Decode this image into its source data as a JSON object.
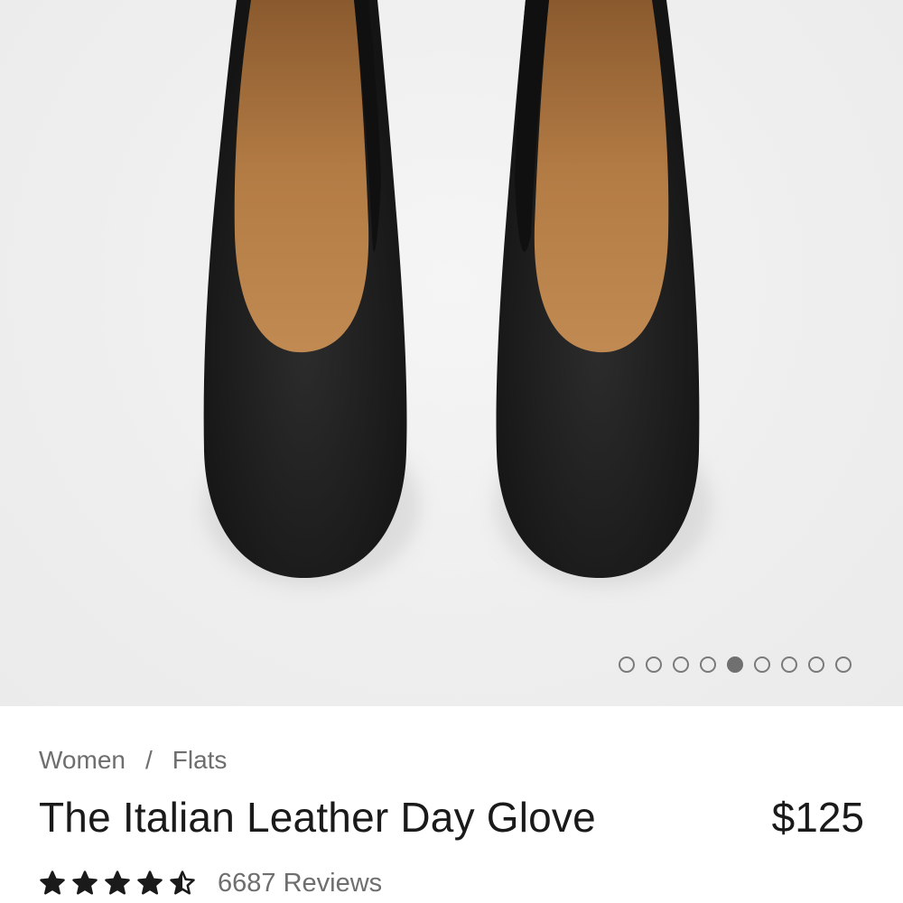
{
  "gallery": {
    "image_alt": "Black leather flats, top view",
    "slide_count": 9,
    "active_slide": 5
  },
  "breadcrumb": {
    "items": [
      "Women",
      "Flats"
    ],
    "separator": "/"
  },
  "product": {
    "title": "The Italian Leather Day Glove",
    "price": "$125"
  },
  "rating": {
    "stars": 4.5,
    "max_stars": 5,
    "reviews_label": "6687 Reviews"
  },
  "colors": {
    "text": "#1a1a1a",
    "muted": "#6e6e6e",
    "hero_bg": "#eeeeee",
    "shoe_leather": "#1c1c1c",
    "shoe_lining": "#b07a45"
  }
}
